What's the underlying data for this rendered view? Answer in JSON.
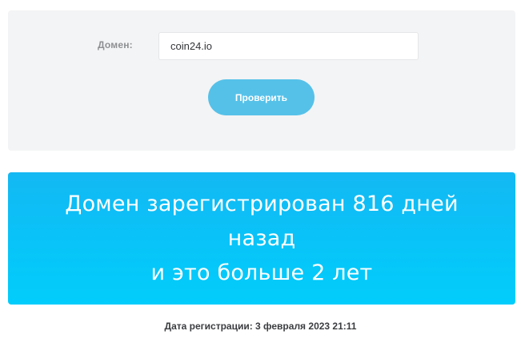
{
  "form": {
    "domain_label": "Домен:",
    "domain_value": "coin24.io",
    "check_button_label": "Проверить"
  },
  "result": {
    "line1": "Домен зарегистрирован 816 дней",
    "line2": "назад",
    "line3": "и это больше 2 лет"
  },
  "registration": {
    "text": "Дата регистрации: 3 февраля 2023 21:11"
  },
  "colors": {
    "panel_background": "#f3f4f5",
    "button": "#55c1e9",
    "banner": "#08c4f8"
  }
}
